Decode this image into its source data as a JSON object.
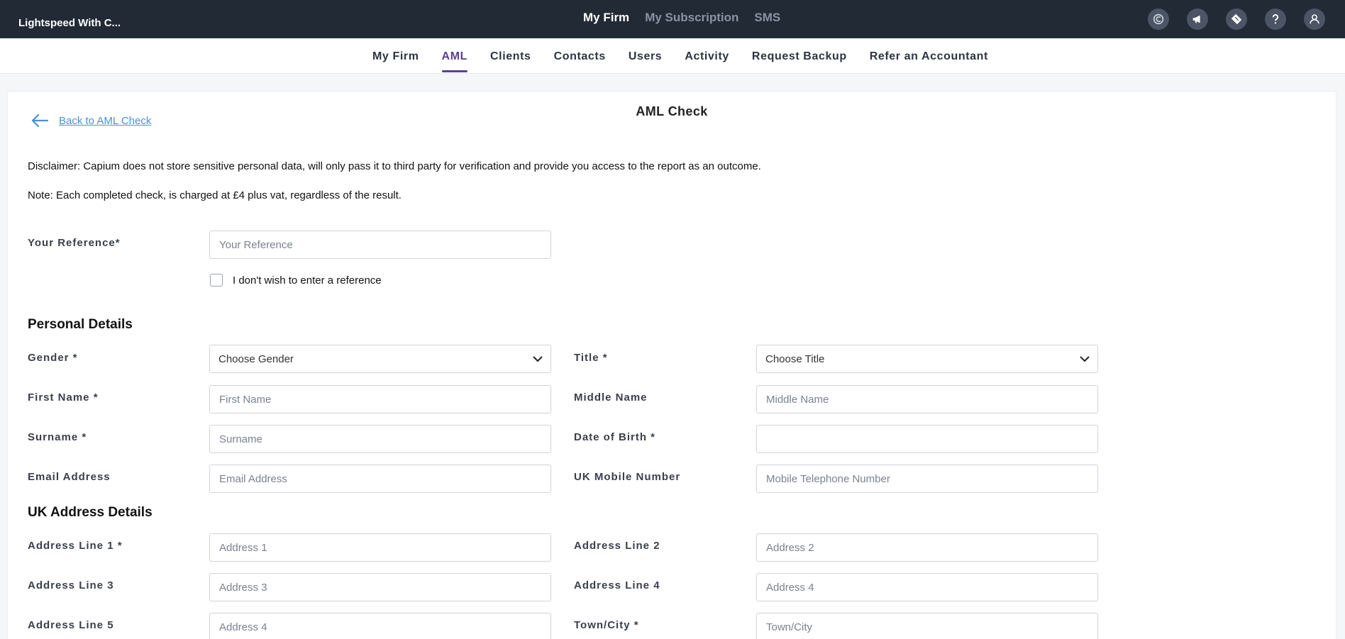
{
  "brand": "Lightspeed With C...",
  "topnav": [
    {
      "label": "My Firm",
      "active": true
    },
    {
      "label": "My Subscription",
      "active": false
    },
    {
      "label": "SMS",
      "active": false
    }
  ],
  "top_icons": [
    "capium-logo-icon",
    "megaphone-icon",
    "ticket-icon",
    "help-icon",
    "user-icon"
  ],
  "subnav": [
    {
      "label": "My Firm",
      "active": false
    },
    {
      "label": "AML",
      "active": true
    },
    {
      "label": "Clients",
      "active": false
    },
    {
      "label": "Contacts",
      "active": false
    },
    {
      "label": "Users",
      "active": false
    },
    {
      "label": "Activity",
      "active": false
    },
    {
      "label": "Request Backup",
      "active": false
    },
    {
      "label": "Refer an Accountant",
      "active": false
    }
  ],
  "page": {
    "back_label": "Back to AML Check",
    "title": "AML Check",
    "disclaimer": "Disclaimer: Capium does not store sensitive personal data, will only pass it to third party for verification and provide you access to the report as an outcome.",
    "note": "Note: Each completed check, is charged at £4 plus vat, regardless of the result."
  },
  "reference": {
    "label": "Your Reference*",
    "placeholder": "Your Reference",
    "checkbox_label": "I don't wish to enter a reference"
  },
  "personal": {
    "heading": "Personal Details",
    "gender_label": "Gender *",
    "gender_value": "Choose Gender",
    "title_label": "Title *",
    "title_value": "Choose Title",
    "first_name_label": "First Name *",
    "first_name_placeholder": "First Name",
    "middle_name_label": "Middle Name",
    "middle_name_placeholder": "Middle Name",
    "surname_label": "Surname *",
    "surname_placeholder": "Surname",
    "dob_label": "Date of Birth *",
    "dob_placeholder": "",
    "email_label": "Email Address",
    "email_placeholder": "Email Address",
    "mobile_label": "UK Mobile Number",
    "mobile_placeholder": "Mobile Telephone Number"
  },
  "address": {
    "heading": "UK Address Details",
    "line1_label": "Address Line 1 *",
    "line1_placeholder": "Address 1",
    "line2_label": "Address Line 2",
    "line2_placeholder": "Address 2",
    "line3_label": "Address Line 3",
    "line3_placeholder": "Address 3",
    "line4_label": "Address Line 4",
    "line4_placeholder": "Address 4",
    "line5_label": "Address Line 5",
    "line5_placeholder": "Address 4",
    "town_label": "Town/City *",
    "town_placeholder": "Town/City"
  }
}
